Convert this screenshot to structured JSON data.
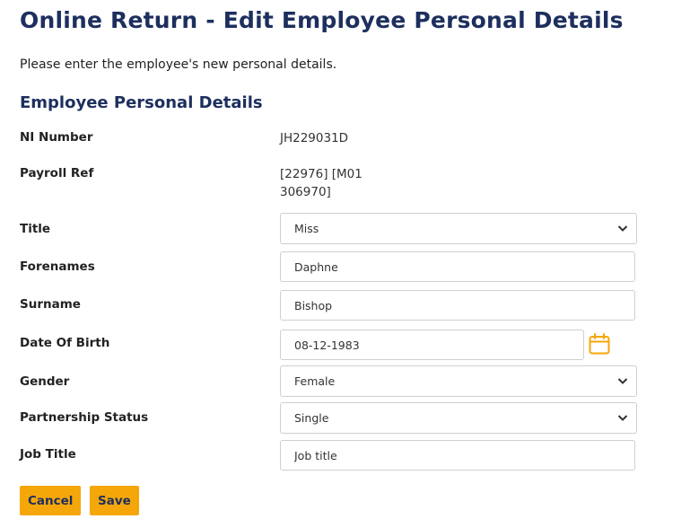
{
  "page": {
    "title": "Online Return - Edit Employee Personal Details",
    "intro": "Please enter the employee's new personal details."
  },
  "section": {
    "title": "Employee Personal Details"
  },
  "fields": {
    "ni_number": {
      "label": "NI Number",
      "value": "JH229031D"
    },
    "payroll_ref": {
      "label": "Payroll Ref",
      "line1": "[22976] [M01",
      "line2": "306970]"
    },
    "title": {
      "label": "Title",
      "value": "Miss"
    },
    "forenames": {
      "label": "Forenames",
      "value": "Daphne"
    },
    "surname": {
      "label": "Surname",
      "value": "Bishop"
    },
    "date_of_birth": {
      "label": "Date Of Birth",
      "value": "08-12-1983"
    },
    "gender": {
      "label": "Gender",
      "value": "Female"
    },
    "partnership_status": {
      "label": "Partnership Status",
      "value": "Single"
    },
    "job_title": {
      "label": "Job Title",
      "value": "",
      "placeholder": "Job title"
    }
  },
  "actions": {
    "cancel_label": "Cancel",
    "save_label": "Save"
  },
  "icons": {
    "calendar": "calendar-icon",
    "dropdown": "chevron-down-icon"
  },
  "colors": {
    "heading": "#1d2f5e",
    "button_bg": "#f5a70a",
    "button_text": "#1d2f5e",
    "calendar_icon": "#f5a70a",
    "field_border": "#cfcfcf"
  }
}
